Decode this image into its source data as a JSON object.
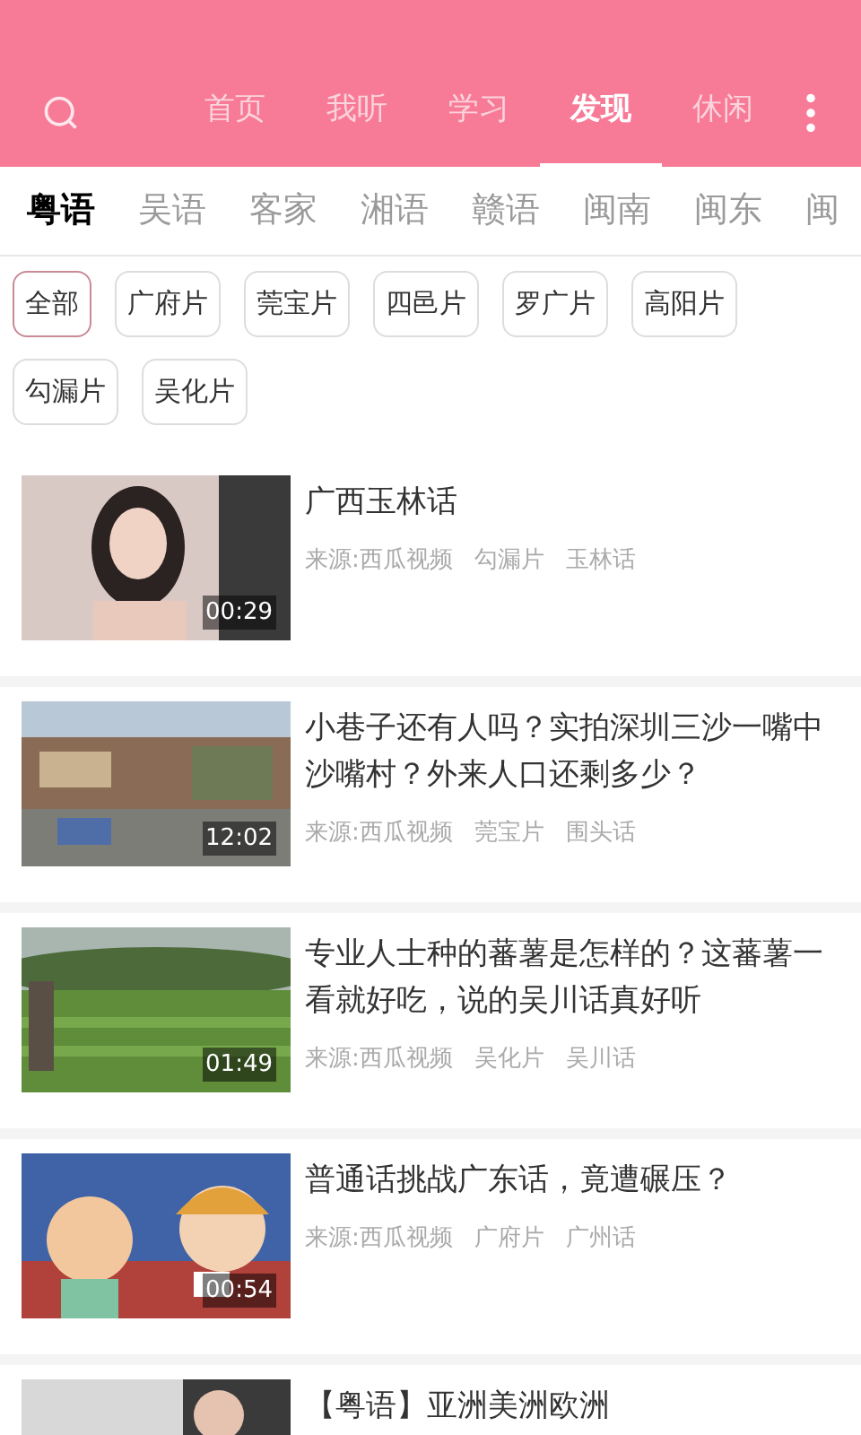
{
  "nav_tabs": [
    {
      "label": "首页",
      "selected": false
    },
    {
      "label": "我听",
      "selected": false
    },
    {
      "label": "学习",
      "selected": false
    },
    {
      "label": "发现",
      "selected": true
    },
    {
      "label": "休闲",
      "selected": false
    }
  ],
  "dialect_tabs": [
    {
      "label": "粤语",
      "selected": true
    },
    {
      "label": "吴语",
      "selected": false
    },
    {
      "label": "客家",
      "selected": false
    },
    {
      "label": "湘语",
      "selected": false
    },
    {
      "label": "赣语",
      "selected": false
    },
    {
      "label": "闽南",
      "selected": false
    },
    {
      "label": "闽东",
      "selected": false
    },
    {
      "label": "闽",
      "selected": false
    }
  ],
  "filter_chips": [
    {
      "label": "全部",
      "selected": true
    },
    {
      "label": "广府片",
      "selected": false
    },
    {
      "label": "莞宝片",
      "selected": false
    },
    {
      "label": "四邑片",
      "selected": false
    },
    {
      "label": "罗广片",
      "selected": false
    },
    {
      "label": "高阳片",
      "selected": false
    },
    {
      "label": "勾漏片",
      "selected": false
    },
    {
      "label": "吴化片",
      "selected": false
    }
  ],
  "videos": [
    {
      "title": "广西玉林话",
      "duration": "00:29",
      "source": "来源:西瓜视频",
      "region": "勾漏片",
      "dialect": "玉林话"
    },
    {
      "title": "小巷子还有人吗？实拍深圳三沙一嘴中沙嘴村？外来人口还剩多少？",
      "duration": "12:02",
      "source": "来源:西瓜视频",
      "region": "莞宝片",
      "dialect": "围头话"
    },
    {
      "title": "专业人士种的蕃薯是怎样的？这蕃薯一看就好吃，说的吴川话真好听",
      "duration": "01:49",
      "source": "来源:西瓜视频",
      "region": "吴化片",
      "dialect": "吴川话"
    },
    {
      "title": "普通话挑战广东话，竟遭碾压？",
      "duration": "00:54",
      "source": "来源:西瓜视频",
      "region": "广府片",
      "dialect": "广州话"
    },
    {
      "title": "【粤语】亚洲美洲欧洲"
    }
  ]
}
